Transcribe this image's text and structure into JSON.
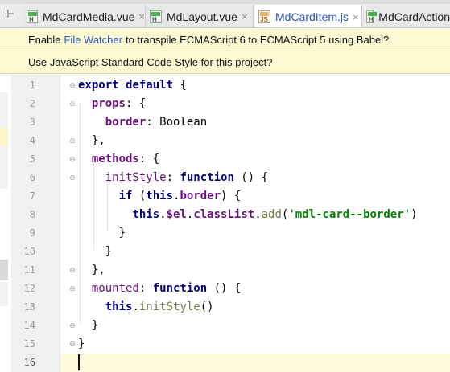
{
  "tabs": [
    {
      "label": "MdCardMedia.vue",
      "type": "vue",
      "active": false
    },
    {
      "label": "MdLayout.vue",
      "type": "vue",
      "active": false
    },
    {
      "label": "MdCardItem.js",
      "type": "js",
      "active": true
    },
    {
      "label": "MdCardAction",
      "type": "vue",
      "active": false
    }
  ],
  "tab_close_glyph": "×",
  "banner_file_watcher": {
    "prefix": "Enable",
    "link": "File Watcher",
    "suffix": "to transpile ECMAScript 6 to ECMAScript 5 using Babel?"
  },
  "banner_code_style": {
    "text": "Use JavaScript Standard Code Style for this project?"
  },
  "editor": {
    "current_line": 16,
    "lines": [
      {
        "n": "1",
        "tokens": [
          [
            "kw",
            "export "
          ],
          [
            "kw",
            "default "
          ],
          [
            "pl",
            "{"
          ]
        ]
      },
      {
        "n": "2",
        "tokens": [
          [
            "pl",
            "  "
          ],
          [
            "prop",
            "props"
          ],
          [
            "pl",
            ": {"
          ]
        ]
      },
      {
        "n": "3",
        "tokens": [
          [
            "pl",
            "    "
          ],
          [
            "prop",
            "border"
          ],
          [
            "pl",
            ": Boolean"
          ]
        ]
      },
      {
        "n": "4",
        "tokens": [
          [
            "pl",
            "  },"
          ]
        ]
      },
      {
        "n": "5",
        "tokens": [
          [
            "pl",
            "  "
          ],
          [
            "prop",
            "methods"
          ],
          [
            "pl",
            ": {"
          ]
        ]
      },
      {
        "n": "6",
        "tokens": [
          [
            "pl",
            "    "
          ],
          [
            "fn",
            "initStyle"
          ],
          [
            "pl",
            ": "
          ],
          [
            "kw",
            "function"
          ],
          [
            "pl",
            " () {"
          ]
        ]
      },
      {
        "n": "7",
        "tokens": [
          [
            "pl",
            "      "
          ],
          [
            "kw",
            "if"
          ],
          [
            "pl",
            " ("
          ],
          [
            "kw",
            "this"
          ],
          [
            "pl",
            "."
          ],
          [
            "prop",
            "border"
          ],
          [
            "pl",
            ") {"
          ]
        ]
      },
      {
        "n": "8",
        "tokens": [
          [
            "pl",
            "        "
          ],
          [
            "kw",
            "this"
          ],
          [
            "pl",
            "."
          ],
          [
            "prop",
            "$el"
          ],
          [
            "pl",
            "."
          ],
          [
            "prop",
            "classList"
          ],
          [
            "pl",
            "."
          ],
          [
            "meth",
            "add"
          ],
          [
            "pl",
            "("
          ],
          [
            "str",
            "'mdl-card--border'"
          ],
          [
            "pl",
            ")"
          ]
        ]
      },
      {
        "n": "9",
        "tokens": [
          [
            "pl",
            "      }"
          ]
        ]
      },
      {
        "n": "10",
        "tokens": [
          [
            "pl",
            "    }"
          ]
        ]
      },
      {
        "n": "11",
        "tokens": [
          [
            "pl",
            "  },"
          ]
        ]
      },
      {
        "n": "12",
        "tokens": [
          [
            "pl",
            "  "
          ],
          [
            "fn",
            "mounted"
          ],
          [
            "pl",
            ": "
          ],
          [
            "kw",
            "function"
          ],
          [
            "pl",
            " () {"
          ]
        ]
      },
      {
        "n": "13",
        "tokens": [
          [
            "pl",
            "    "
          ],
          [
            "kw",
            "this"
          ],
          [
            "pl",
            "."
          ],
          [
            "meth",
            "initStyle"
          ],
          [
            "pl",
            "()"
          ]
        ]
      },
      {
        "n": "14",
        "tokens": [
          [
            "pl",
            "  }"
          ]
        ]
      },
      {
        "n": "15",
        "tokens": [
          [
            "pl",
            "}"
          ]
        ]
      },
      {
        "n": "16",
        "tokens": []
      }
    ]
  },
  "colors": {
    "keyword": "#000080",
    "property": "#660e7a",
    "string": "#008000",
    "banner_bg": "#fcf8d2",
    "link": "#2a55c9",
    "current_line_bg": "#fffbdd"
  }
}
